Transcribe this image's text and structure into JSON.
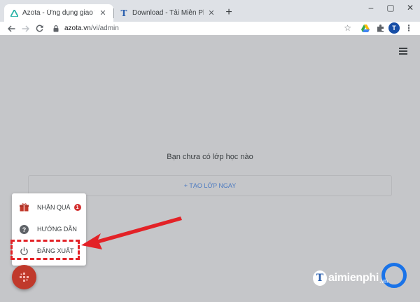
{
  "browser": {
    "tabs": [
      {
        "title": "Azota - Ứng dụng giao và chấm l",
        "active": true
      },
      {
        "title": "Download - Tải Miễn Phí VN - Pl",
        "active": false
      }
    ],
    "url_host": "azota.vn",
    "url_path": "/vi/admin",
    "avatar_letter": "T"
  },
  "page": {
    "empty_message": "Bạn chưa có lớp học nào",
    "create_class_label": "+ TẠO LỚP NGAY"
  },
  "menu": {
    "items": [
      {
        "label": "NHẬN QUÀ",
        "badge": "1",
        "icon": "gift-icon"
      },
      {
        "label": "HƯỚNG DẪN",
        "icon": "help-icon"
      },
      {
        "label": "ĐĂNG XUẤT",
        "icon": "power-icon"
      }
    ]
  },
  "watermark": {
    "logo_letter": "T",
    "text": "aimienphi",
    "tld": ".vn"
  },
  "colors": {
    "accent_red": "#e32227",
    "fab_red": "#c0392b",
    "link_blue": "#4d7bc1"
  }
}
